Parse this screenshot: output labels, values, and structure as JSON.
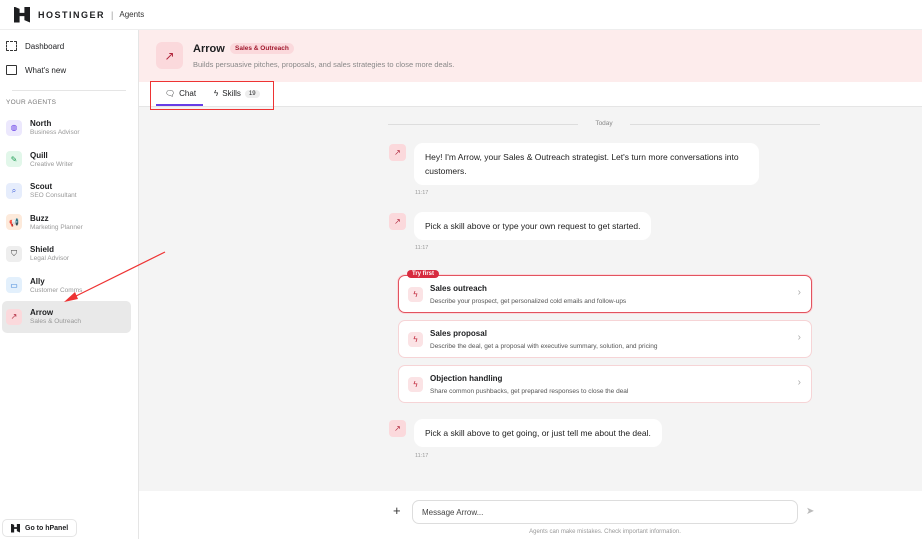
{
  "header": {
    "brand": "HOSTINGER",
    "product": "Agents"
  },
  "sidebar": {
    "nav": [
      {
        "label": "Dashboard",
        "icon": "grid-icon"
      },
      {
        "label": "What's new",
        "icon": "window-icon"
      }
    ],
    "section_label": "YOUR AGENTS",
    "agents": [
      {
        "name": "North",
        "role": "Business Advisor",
        "icon": "globe-icon",
        "bg": "#ece8fd",
        "fg": "#673de6",
        "glyph": "◍"
      },
      {
        "name": "Quill",
        "role": "Creative Writer",
        "icon": "pencil-icon",
        "bg": "#e2f7ea",
        "fg": "#1f9d55",
        "glyph": "✎"
      },
      {
        "name": "Scout",
        "role": "SEO Consultant",
        "icon": "search-icon",
        "bg": "#e6edfc",
        "fg": "#3b5bd9",
        "glyph": "⌕"
      },
      {
        "name": "Buzz",
        "role": "Marketing Planner",
        "icon": "megaphone-icon",
        "bg": "#fdeadb",
        "fg": "#e0611c",
        "glyph": "📢"
      },
      {
        "name": "Shield",
        "role": "Legal Advisor",
        "icon": "shield-icon",
        "bg": "#eeeeee",
        "fg": "#333333",
        "glyph": "⛉"
      },
      {
        "name": "Ally",
        "role": "Customer Comms",
        "icon": "chat-bubble-icon",
        "bg": "#e3f0fc",
        "fg": "#1f6fd1",
        "glyph": "▭"
      },
      {
        "name": "Arrow",
        "role": "Sales & Outreach",
        "icon": "arrow-up-right-icon",
        "bg": "#fbd9dc",
        "fg": "#b0243a",
        "glyph": "↗"
      }
    ],
    "hpanel": "Go to hPanel"
  },
  "agent": {
    "name": "Arrow",
    "badge": "Sales & Outreach",
    "description": "Builds persuasive pitches, proposals, and sales strategies to close more deals."
  },
  "tabs": {
    "chat": "Chat",
    "skills": "Skills",
    "skills_count": "19"
  },
  "chat": {
    "date_divider": "Today",
    "messages": [
      {
        "text": "Hey! I'm Arrow, your Sales & Outreach strategist. Let's turn more conversations into customers.",
        "time": "11:17"
      },
      {
        "text": "Pick a skill above or type your own request to get started.",
        "time": "11:17"
      },
      {
        "text": "Pick a skill above to get going, or just tell me about the deal.",
        "time": "11:17"
      }
    ],
    "try_first": "Try first",
    "skills": [
      {
        "title": "Sales outreach",
        "desc": "Describe your prospect, get personalized cold emails and follow-ups"
      },
      {
        "title": "Sales proposal",
        "desc": "Describe the deal, get a proposal with executive summary, solution, and pricing"
      },
      {
        "title": "Objection handling",
        "desc": "Share common pushbacks, get prepared responses to close the deal"
      }
    ]
  },
  "composer": {
    "placeholder": "Message Arrow...",
    "disclaimer": "Agents can make mistakes. Check important information."
  },
  "colors": {
    "accent": "#673de6",
    "brand_red": "#d72b3f",
    "banner_bg": "#fdecec"
  }
}
